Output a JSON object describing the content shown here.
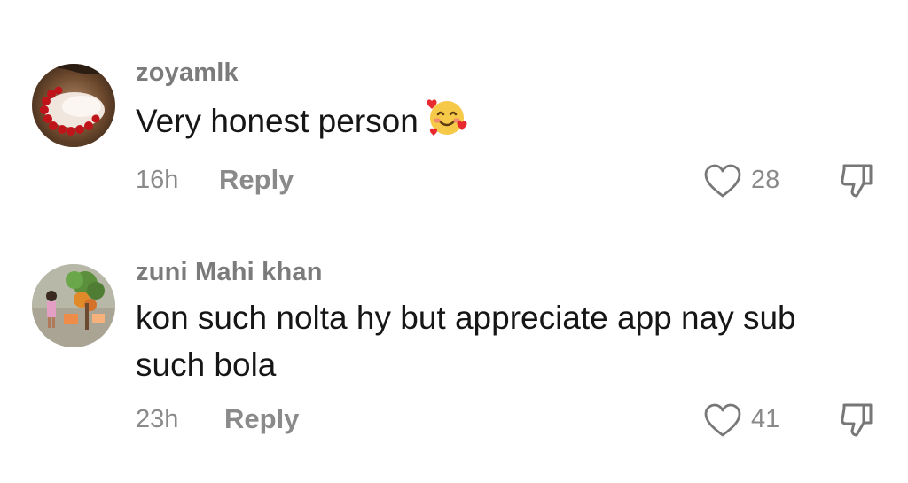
{
  "comments": [
    {
      "username": "zoyamlk",
      "text": "Very honest person",
      "emoji": "smiling-face-with-hearts",
      "time": "16h",
      "reply_label": "Reply",
      "likes": "28"
    },
    {
      "username": "zuni Mahi khan",
      "text": "kon such nolta hy but appreciate app nay sub such bola",
      "time": "23h",
      "reply_label": "Reply",
      "likes": "41"
    }
  ],
  "colors": {
    "username": "#7b7b7b",
    "text": "#161616",
    "meta": "#8a8a8a",
    "background": "#ffffff"
  }
}
